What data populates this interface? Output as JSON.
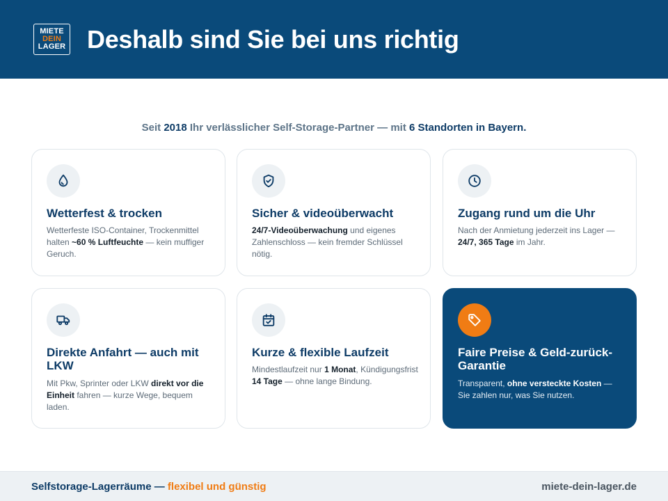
{
  "header": {
    "logo": {
      "line1": "MIETE",
      "line2": "DEIN",
      "line3": "LAGER"
    },
    "title": "Deshalb sind Sie bei uns richtig"
  },
  "subtitle": {
    "part1": "Seit ",
    "year": "2018",
    "part2": " Ihr verlässlicher Self-Storage-Partner — mit ",
    "locations": "6 Standorten in Bayern",
    "part3": "."
  },
  "cards": [
    {
      "icon": "droplet-icon",
      "title": "Wetterfest & trocken",
      "text_a": "Wetterfeste ISO-Container, Trockenmittel halten ",
      "text_b": "~60 % Luftfeuchte",
      "text_c": " — kein muffiger Geruch."
    },
    {
      "icon": "shield-check-icon",
      "title": "Sicher & videoüberwacht",
      "text_a": "",
      "text_b": "24/7-Videoüberwachung",
      "text_c": " und eigenes Zahlenschloss — kein fremder Schlüssel nötig."
    },
    {
      "icon": "clock-icon",
      "title": "Zugang rund um die Uhr",
      "text_a": "Nach der Anmietung jederzeit ins Lager — ",
      "text_b": "24/7, 365 Tage",
      "text_c": " im Jahr."
    },
    {
      "icon": "truck-icon",
      "title": "Direkte Anfahrt — auch mit LKW",
      "text_a": "Mit Pkw, Sprinter oder LKW ",
      "text_b": "direkt vor die Einheit",
      "text_c": " fahren — kurze Wege, bequem laden."
    },
    {
      "icon": "calendar-check-icon",
      "title": "Kurze & flexible Laufzeit",
      "text_a": "Mindestlaufzeit nur ",
      "text_b": "1 Monat",
      "text_c": ", Kündigungsfrist ",
      "text_d": "14 Tage",
      "text_e": " — ohne lange Bindung."
    },
    {
      "icon": "tag-icon",
      "title": "Faire Preise & Geld-zurück-Garantie",
      "text_a": "Transparent, ",
      "text_b": "ohne versteckte Kosten",
      "text_c": " — Sie zahlen nur, was Sie nutzen."
    }
  ],
  "footer": {
    "left_a": "Selfstorage-Lagerräume — ",
    "left_b": "flexibel und günstig",
    "right": "miete-dein-lager.de"
  },
  "colors": {
    "primary": "#0a4a7a",
    "accent": "#f07c14",
    "icon_bg": "#edf1f4"
  }
}
